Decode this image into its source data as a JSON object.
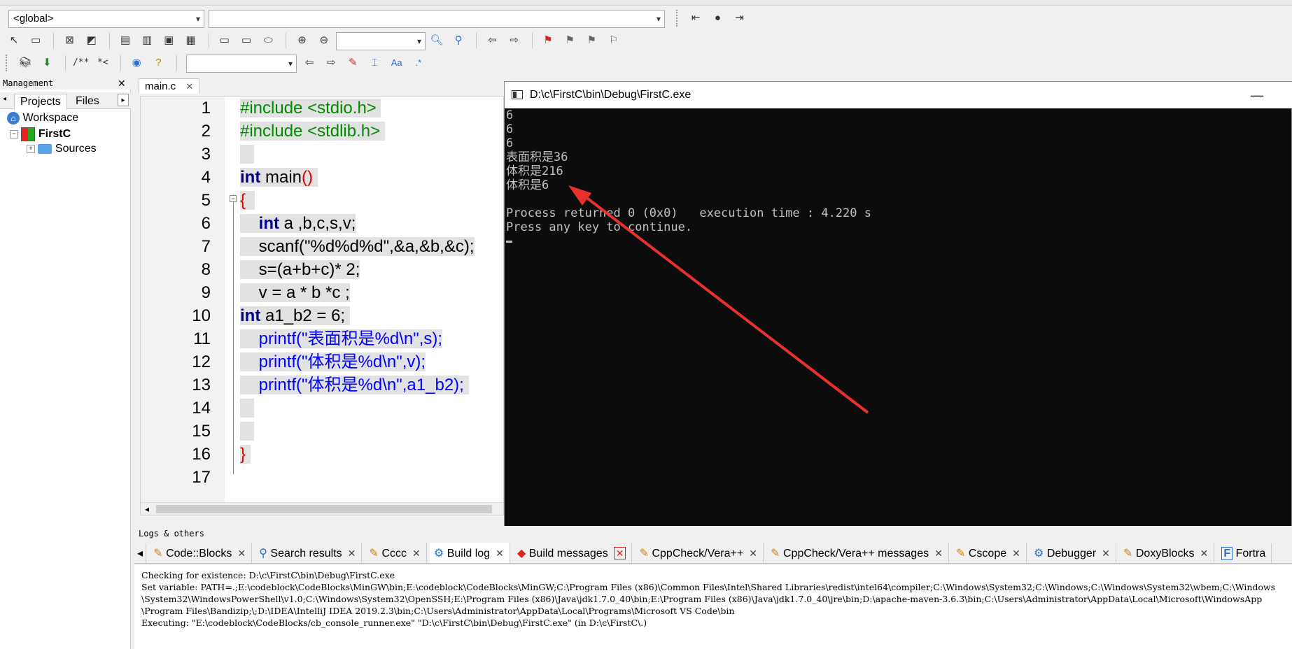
{
  "toolbar": {
    "scope_combo": "<global>",
    "symbol_combo": "",
    "search_combo": "",
    "regex_combo": ""
  },
  "management": {
    "title": "Management",
    "tab_projects": "Projects",
    "tab_files": "Files",
    "workspace": "Workspace",
    "project": "FirstC",
    "sources": "Sources"
  },
  "editor": {
    "tab": "main.c",
    "lines": [
      "1",
      "2",
      "3",
      "4",
      "5",
      "6",
      "7",
      "8",
      "9",
      "10",
      "11",
      "12",
      "13",
      "14",
      "15",
      "16",
      "17"
    ],
    "code": {
      "l1": "#include <stdio.h>",
      "l2": "#include <stdlib.h>",
      "l4_kw": "int",
      "l4_rest": " main",
      "l4_paren": "()",
      "l5": "{",
      "l6_kw": "int",
      "l6_rest": " a ,b,c,s,v;",
      "l7": "scanf(\"%d%d%d\",&a,&b,&c);",
      "l8": "s=(a+b+c)* 2;",
      "l9": "v = a * b *c ;",
      "l10_kw": "int",
      "l10_rest": " a1_b2 = 6;",
      "l11": "printf(\"表面积是%d\\n\",s);",
      "l12": "printf(\"体积是%d\\n\",v);",
      "l13": "printf(\"体积是%d\\n\",a1_b2);",
      "l16": "}"
    }
  },
  "console": {
    "title": "D:\\c\\FirstC\\bin\\Debug\\FirstC.exe",
    "lines": [
      "6",
      "6",
      "6",
      "表面积是36",
      "体积是216",
      "体积是6",
      "",
      "Process returned 0 (0x0)   execution time : 4.220 s",
      "Press any key to continue."
    ]
  },
  "logs": {
    "title": "Logs & others",
    "tabs": [
      "Code::Blocks",
      "Search results",
      "Cccc",
      "Build log",
      "Build messages",
      "CppCheck/Vera++",
      "CppCheck/Vera++ messages",
      "Cscope",
      "Debugger",
      "DoxyBlocks",
      "Fortra"
    ],
    "lines": [
      "Checking for existence: D:\\c\\FirstC\\bin\\Debug\\FirstC.exe",
      "Set variable: PATH=.;E:\\codeblock\\CodeBlocks\\MinGW\\bin;E:\\codeblock\\CodeBlocks\\MinGW;C:\\Program Files (x86)\\Common Files\\Intel\\Shared Libraries\\redist\\intel64\\compiler;C:\\Windows\\System32;C:\\Windows;C:\\Windows\\System32\\wbem;C:\\Windows",
      "\\System32\\WindowsPowerShell\\v1.0;C:\\Windows\\System32\\OpenSSH;E:\\Program Files (x86)\\Java\\jdk1.7.0_40\\bin;E:\\Program Files (x86)\\Java\\jdk1.7.0_40\\jre\\bin;D:\\apache-maven-3.6.3\\bin;C:\\Users\\Administrator\\AppData\\Local\\Microsoft\\WindowsApp",
      "\\Program Files\\Bandizip;\\;D:\\IDEA\\IntelliJ IDEA 2019.2.3\\bin;C:\\Users\\Administrator\\AppData\\Local\\Programs\\Microsoft VS Code\\bin",
      "Executing: \"E:\\codeblock\\CodeBlocks/cb_console_runner.exe\" \"D:\\c\\FirstC\\bin\\Debug\\FirstC.exe\"  (in D:\\c\\FirstC\\.)"
    ]
  },
  "colors": {
    "arrow": "#e8302c",
    "keyword": "#00008b",
    "preprocessor": "#008a00",
    "operator": "#e00000",
    "string": "#0000ff",
    "number": "#e000e0"
  },
  "icons": [
    "pointer-icon",
    "zoom-in-icon",
    "zoom-out-icon",
    "bookmark-icon",
    "search-icon",
    "jump-back-icon",
    "jump-forward-icon",
    "close-icon",
    "workspace-icon",
    "project-icon",
    "folder-icon",
    "console-icon",
    "minimize-icon"
  ]
}
